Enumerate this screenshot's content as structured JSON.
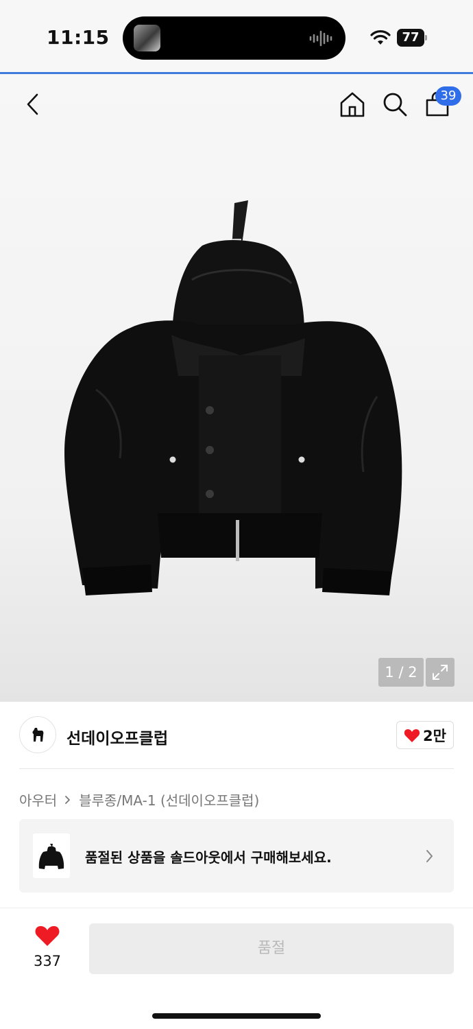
{
  "status_bar": {
    "time": "11:15",
    "battery": "77",
    "icons": [
      "wifi-icon",
      "audio-wave-icon"
    ]
  },
  "header": {
    "cart_count": "39",
    "icons": [
      "back-chevron-icon",
      "home-icon",
      "search-icon",
      "shopping-bag-icon"
    ]
  },
  "gallery": {
    "page_indicator": "1 / 2",
    "current_page": 1,
    "total_pages": 2
  },
  "brand": {
    "name": "선데이오프클럽",
    "likes": "2만"
  },
  "breadcrumb": {
    "category": "아우터",
    "subcategory": "블루종/MA-1 (선데이오프클럽)"
  },
  "soldout_banner": {
    "text": "품절된 상품을 솔드아웃에서 구매해보세요."
  },
  "bottom_bar": {
    "wish_count": "337",
    "buy_button_label": "품절"
  },
  "colors": {
    "accent": "#3d7bdc",
    "badge": "#2f6ee8",
    "heart": "#ee1b24"
  }
}
